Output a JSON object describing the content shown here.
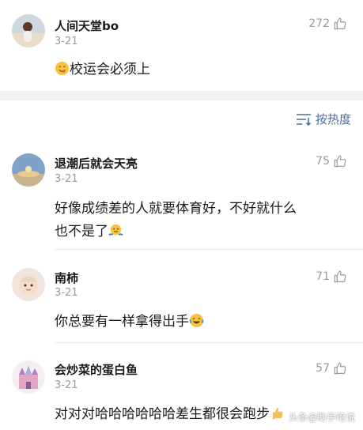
{
  "comments_top": {
    "username": "人间天堂bo",
    "date": "3-21",
    "likes": "272",
    "text": "校运会必须上",
    "emoji": "yum-face"
  },
  "sort": {
    "label": "按热度",
    "icon": "sort-lines-icon"
  },
  "comments": [
    {
      "username": "退潮后就会天亮",
      "date": "3-21",
      "likes": "75",
      "text_line1": "好像成绩差的人就要体育好，不好就什么",
      "text_line2": "也不是了",
      "emoji": "shrug-face"
    },
    {
      "username": "南柿",
      "date": "3-21",
      "likes": "71",
      "text": "你总要有一样拿得出手",
      "emoji": "laughing-tears-face"
    },
    {
      "username": "会炒菜的蛋白鱼",
      "date": "3-21",
      "likes": "57",
      "text": "对对对哈哈哈哈哈哈差生都很会跑步",
      "emoji": "thumbs-up"
    }
  ],
  "watermark": {
    "text": "头条@助手哈说"
  },
  "colors": {
    "link": "#4b6f9e",
    "muted": "#9a9a9a",
    "band": "#f1f1f3"
  }
}
